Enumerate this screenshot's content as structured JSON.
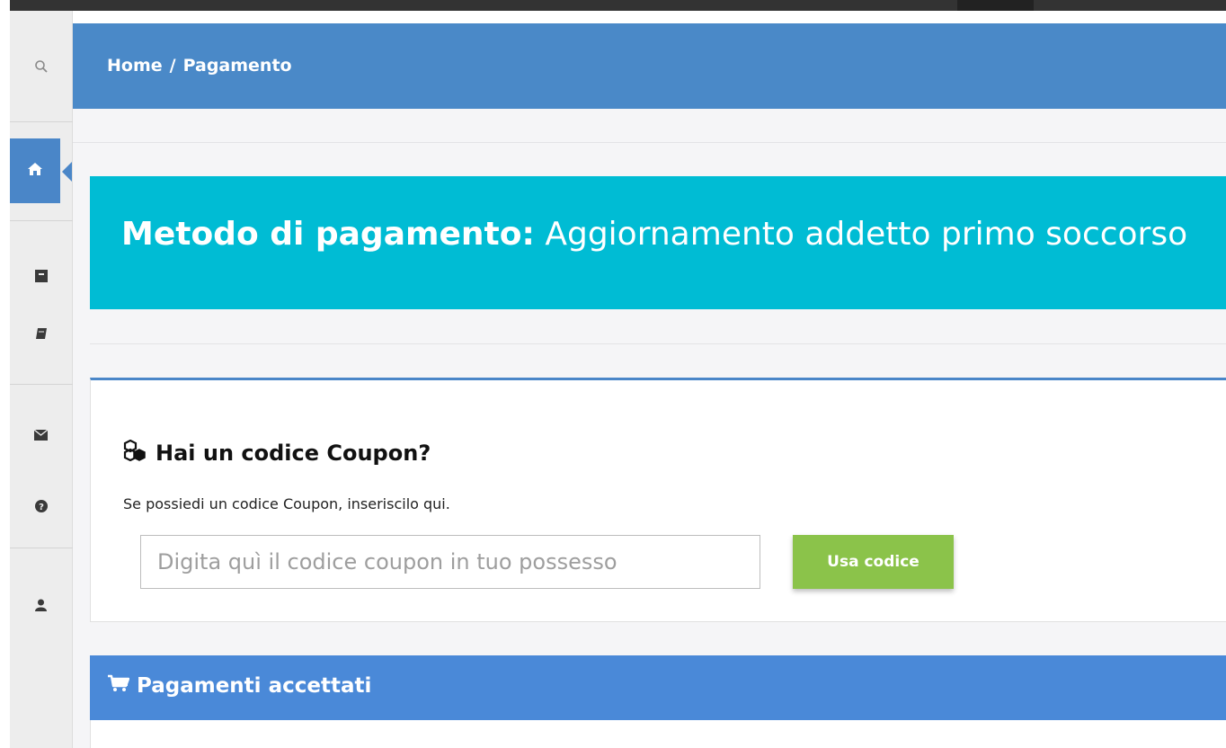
{
  "breadcrumb": {
    "home": "Home",
    "separator": "/",
    "current": "Pagamento"
  },
  "sidebar": {
    "icons": [
      "search-icon",
      "home-icon",
      "archive-icon",
      "book-icon",
      "envelope-icon",
      "question-circle-icon",
      "user-icon"
    ],
    "active": "home-icon"
  },
  "banner": {
    "label_bold": "Metodo di pagamento:",
    "label_course": "Aggiornamento addetto primo soccorso"
  },
  "coupon": {
    "title": "Hai un codice Coupon?",
    "description": "Se possiedi un codice Coupon, inseriscilo qui.",
    "input_placeholder": "Digita quì il codice coupon in tuo possesso",
    "input_value": "",
    "button_label": "Usa codice"
  },
  "payments": {
    "title": "Pagamenti accettati"
  },
  "colors": {
    "header": "#4a89c8",
    "banner": "#00bcd4",
    "button": "#8bc34a",
    "payments_header": "#4a89d8"
  }
}
